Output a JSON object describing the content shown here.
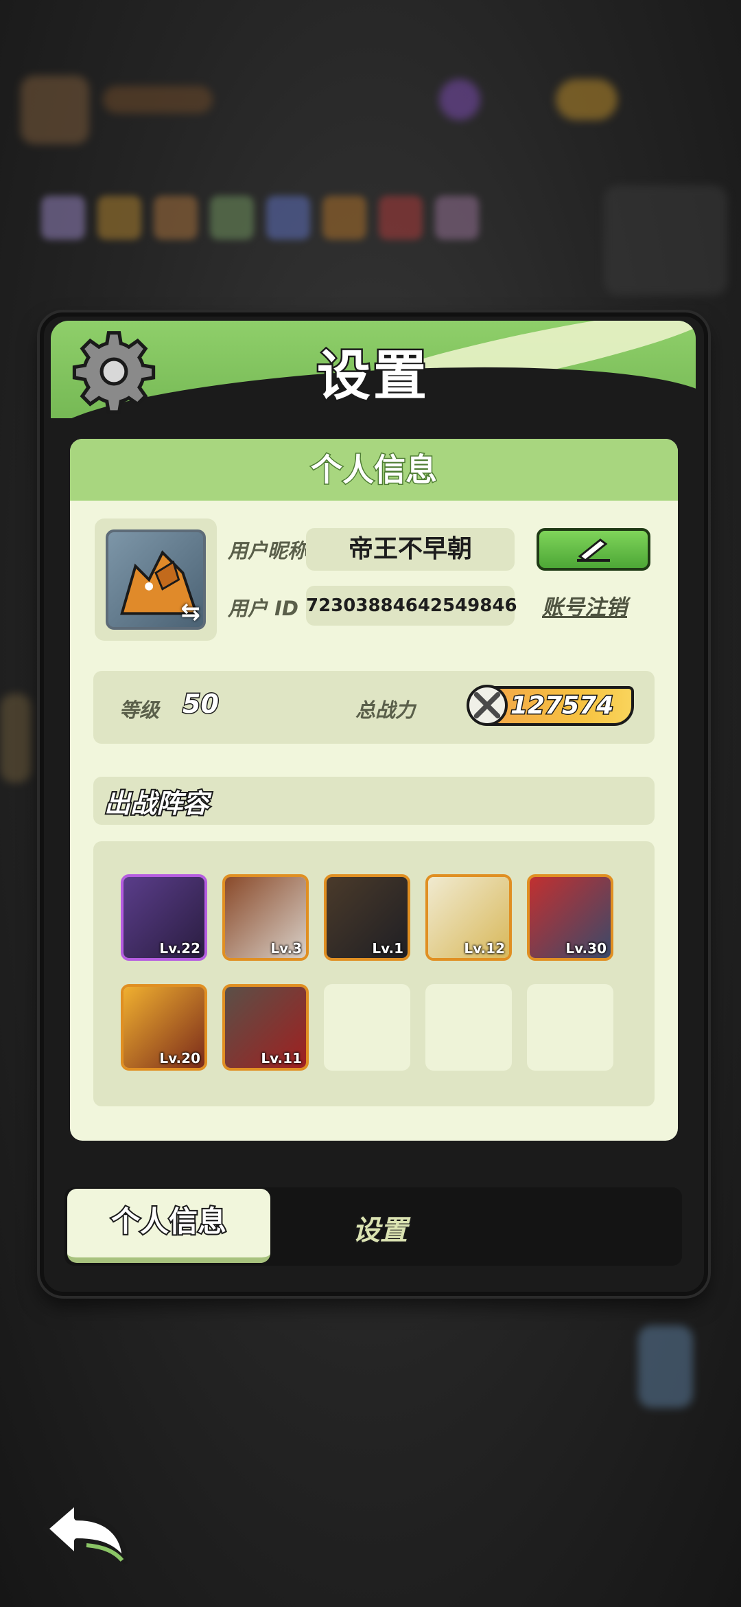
{
  "dialog": {
    "title": "设置"
  },
  "profile": {
    "section_title": "个人信息",
    "nickname_label": "用户昵称",
    "nickname": "帝王不早朝",
    "id_label": "用户 ID",
    "user_id": "72303884642549846",
    "deregister_label": "账号注销",
    "level_label": "等级",
    "level": "50",
    "power_label": "总战力",
    "power": "127574"
  },
  "lineup": {
    "title": "出战阵容",
    "heroes": [
      {
        "level": "Lv.22",
        "frame": "purple",
        "art": "#3b2a5a"
      },
      {
        "level": "Lv.3",
        "frame": "orange",
        "art": "#6b3a26"
      },
      {
        "level": "Lv.1",
        "frame": "orange",
        "art": "#2f2f33"
      },
      {
        "level": "Lv.12",
        "frame": "orange",
        "art": "#d8c58a"
      },
      {
        "level": "Lv.30",
        "frame": "orange",
        "art": "#7a2424"
      },
      {
        "level": "Lv.20",
        "frame": "orange",
        "art": "#8a4a1c"
      },
      {
        "level": "Lv.11",
        "frame": "orange",
        "art": "#3d3530"
      }
    ],
    "empty_slots": 3
  },
  "tabs": [
    {
      "label": "个人信息",
      "active": true
    },
    {
      "label": "设置",
      "active": false
    }
  ]
}
